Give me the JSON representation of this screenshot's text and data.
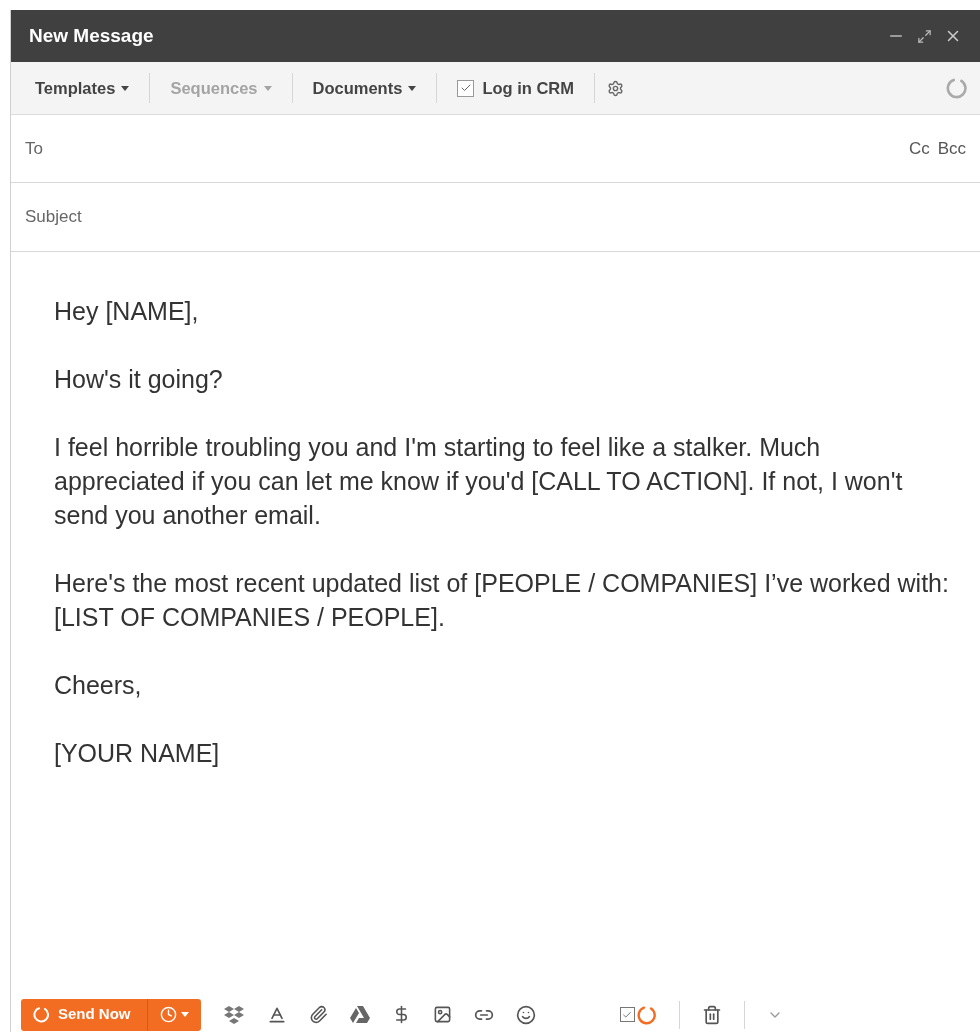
{
  "window": {
    "title": "New Message"
  },
  "toolbar": [
    {
      "kind": "dropdown",
      "label": "Templates",
      "disabled": false
    },
    {
      "kind": "dropdown",
      "label": "Sequences",
      "disabled": true
    },
    {
      "kind": "dropdown",
      "label": "Documents",
      "disabled": false
    },
    {
      "kind": "checkbox",
      "label": "Log in CRM",
      "checked": true
    }
  ],
  "to": {
    "placeholder": "To",
    "cc": "Cc",
    "bcc": "Bcc"
  },
  "subject": {
    "placeholder": "Subject"
  },
  "body": [
    "Hey [NAME],",
    "How's it going?",
    "I feel horrible troubling you and I'm starting to feel like a stalker. Much appreciated if you can let me know if you'd [CALL TO ACTION]. If not, I won't send you another email.",
    "Here's the most recent updated list of [PEOPLE / COMPANIES] I’ve worked with: [LIST OF COMPANIES / PEOPLE].",
    "Cheers,",
    "[YOUR NAME]"
  ],
  "send": {
    "label": "Send Now"
  },
  "tracking": {
    "checked": true
  }
}
